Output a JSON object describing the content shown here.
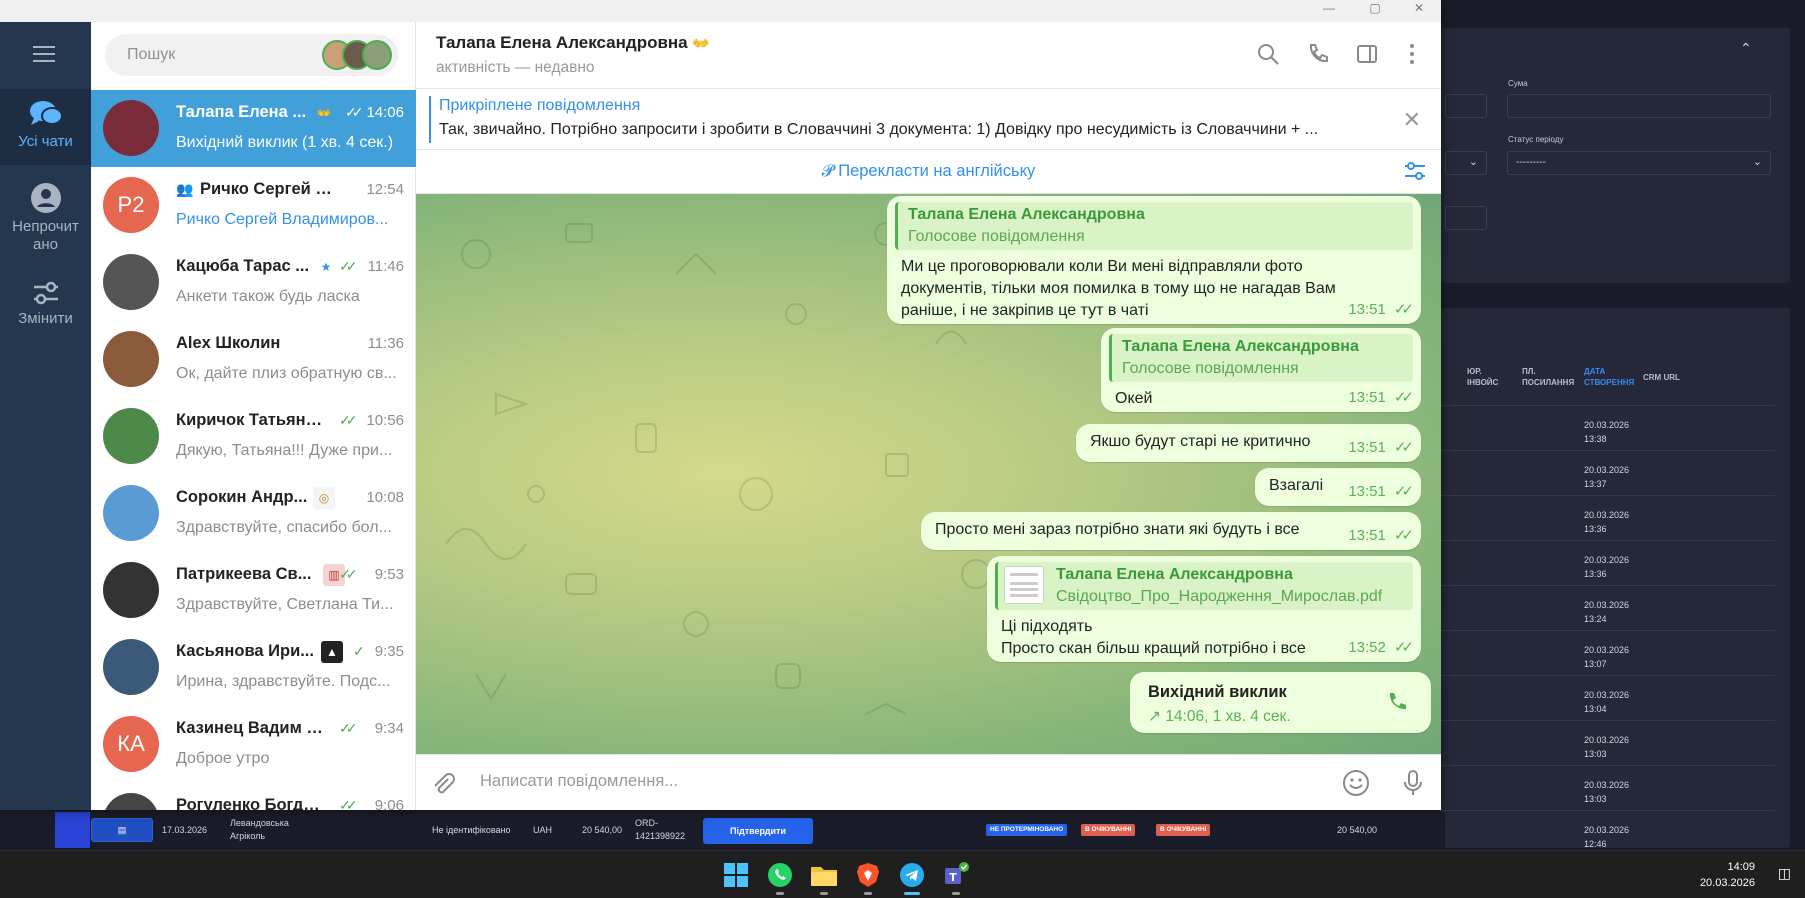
{
  "crm": {
    "labels": {
      "sum": "Сума",
      "period_status": "Статус періоду"
    },
    "period_select_value": "---------",
    "table_headers": [
      "ЮР. ІНВОЙС",
      "ПЛ. ПОСИЛАННЯ",
      "ДАТА СТВОРЕННЯ",
      "CRM URL"
    ],
    "rows": [
      {
        "date": "20.03.2026",
        "time": "13:38"
      },
      {
        "date": "20.03.2026",
        "time": "13:37"
      },
      {
        "date": "20.03.2026",
        "time": "13:36"
      },
      {
        "date": "20.03.2026",
        "time": "13:36"
      },
      {
        "date": "20.03.2026",
        "time": "13:24"
      },
      {
        "date": "20.03.2026",
        "time": "13:07"
      },
      {
        "date": "20.03.2026",
        "time": "13:04"
      },
      {
        "date": "20.03.2026",
        "time": "13:03"
      },
      {
        "date": "20.03.2026",
        "time": "13:03"
      },
      {
        "date": "20.03.2026",
        "time": "12:46"
      }
    ],
    "bottom_row": {
      "date": "17.03.2026",
      "client_line1": "Левандовська",
      "client_line2": "Агріколь",
      "status": "Не ідентифіковано",
      "currency": "UAH",
      "amount": "20 540,00",
      "order_line1": "ORD-",
      "order_line2": "1421398922",
      "confirm_label": "Підтвердити",
      "badge1": "НЕ ПРОТЕРМІНОВАНО",
      "badge2": "В ОЧІКУВАННІ",
      "badge3": "В ОЧІКУВАННІ",
      "amount2": "20 540,00"
    }
  },
  "taskbar": {
    "apps": [
      "start-icon",
      "whatsapp-icon",
      "file-explorer-icon",
      "brave-icon",
      "telegram-icon",
      "teams-icon"
    ],
    "clock_time": "14:09",
    "clock_date": "20.03.2026"
  },
  "telegram": {
    "rail": {
      "all_chats": "Усі чати",
      "unread": "Непрочит ано",
      "edit": "Змінити"
    },
    "search_placeholder": "Пошук",
    "chats": [
      {
        "name": "Талапа Елена ...",
        "time": "14:06",
        "preview": "Вихідний виклик (1 хв. 4 сек.)",
        "avatar_text": "",
        "avatar_color": "#7a2b3a",
        "active": true
      },
      {
        "name": "Ричко Сергей Вла...",
        "time": "12:54",
        "preview": "Ричко Сергей Владимиров...",
        "avatar_text": "Р2",
        "avatar_color": "#e5674f",
        "active": false
      },
      {
        "name": "Кацюба Тарас ...",
        "time": "11:46",
        "preview": "Анкети також будь ласка",
        "avatar_text": "",
        "avatar_color": "#555555",
        "active": false
      },
      {
        "name": "Alex Школин",
        "time": "11:36",
        "preview": "Ок, дайте плиз обратную св...",
        "avatar_text": "",
        "avatar_color": "#8a5a3a",
        "active": false
      },
      {
        "name": "Киричок Татьяна ...",
        "time": "10:56",
        "preview": "Дякую,  Татьяна!!! Дуже при...",
        "avatar_text": "",
        "avatar_color": "#4d8a4a",
        "active": false
      },
      {
        "name": "Сорокин Андр...",
        "time": "10:08",
        "preview": "Здравствуйте, спасибо бол...",
        "avatar_text": "",
        "avatar_color": "#5b9bd5",
        "active": false
      },
      {
        "name": "Патрикеева Св...",
        "time": "9:53",
        "preview": "Здравствуйте, Светлана Ти...",
        "avatar_text": "",
        "avatar_color": "#333333",
        "active": false
      },
      {
        "name": "Касьянова Ири...",
        "time": "9:35",
        "preview": "Ирина, здравствуйте. Подс...",
        "avatar_text": "",
        "avatar_color": "#3b5a7a",
        "active": false
      },
      {
        "name": "Казинец Вадим Ал...",
        "time": "9:34",
        "preview": "Доброе утро",
        "avatar_text": "КА",
        "avatar_color": "#e5674f",
        "active": false
      },
      {
        "name": "Рогуленко Богдан ...",
        "time": "9:06",
        "preview": "",
        "avatar_text": "",
        "avatar_color": "#444444",
        "active": false
      }
    ],
    "header": {
      "title": "Талапа Елена Александровна",
      "status": "активність — недавно"
    },
    "pinned": {
      "title": "Прикріплене повідомлення",
      "text": "Так, звичайно. Потрібно запросити і зробити в Словаччині 3 документа: 1) Довідку про несудимість із Словаччини + ..."
    },
    "translate_label": "Перекласти на англійську",
    "messages": [
      {
        "quote_name": "Талапа Елена Александровна",
        "quote_text": "Голосове повідомлення",
        "lines": [
          "Ми це проговорювали коли Ви мені відправляли фото",
          "документів, тільки моя помилка в тому що не нагадав Вам",
          "раніше, і не закріпив це тут в чаті"
        ],
        "time": "13:51"
      },
      {
        "quote_name": "Талапа Елена Александровна",
        "quote_text": "Голосове повідомлення",
        "lines": [
          "Окей"
        ],
        "time": "13:51"
      },
      {
        "lines": [
          "Якшо будут старі не критично"
        ],
        "time": "13:51"
      },
      {
        "lines": [
          "Взагалі"
        ],
        "time": "13:51"
      },
      {
        "lines": [
          "Просто мені зараз потрібно знати які будуть і все"
        ],
        "time": "13:51"
      },
      {
        "quote_name": "Талапа Елена Александровна",
        "quote_text": "Свідоцтво_Про_Народження_Мирослав.pdf",
        "lines": [
          "Ці підходять",
          "Просто скан більш кращий потрібно і все"
        ],
        "time": "13:52"
      }
    ],
    "call": {
      "title": "Вихідний виклик",
      "detail": "14:06, 1 хв. 4 сек."
    },
    "composer_placeholder": "Написати повідомлення..."
  },
  "colors": {
    "accent": "#3390ec",
    "active_chat": "#419fd9",
    "bubble": "#eeffde",
    "rail": "#24374e"
  }
}
